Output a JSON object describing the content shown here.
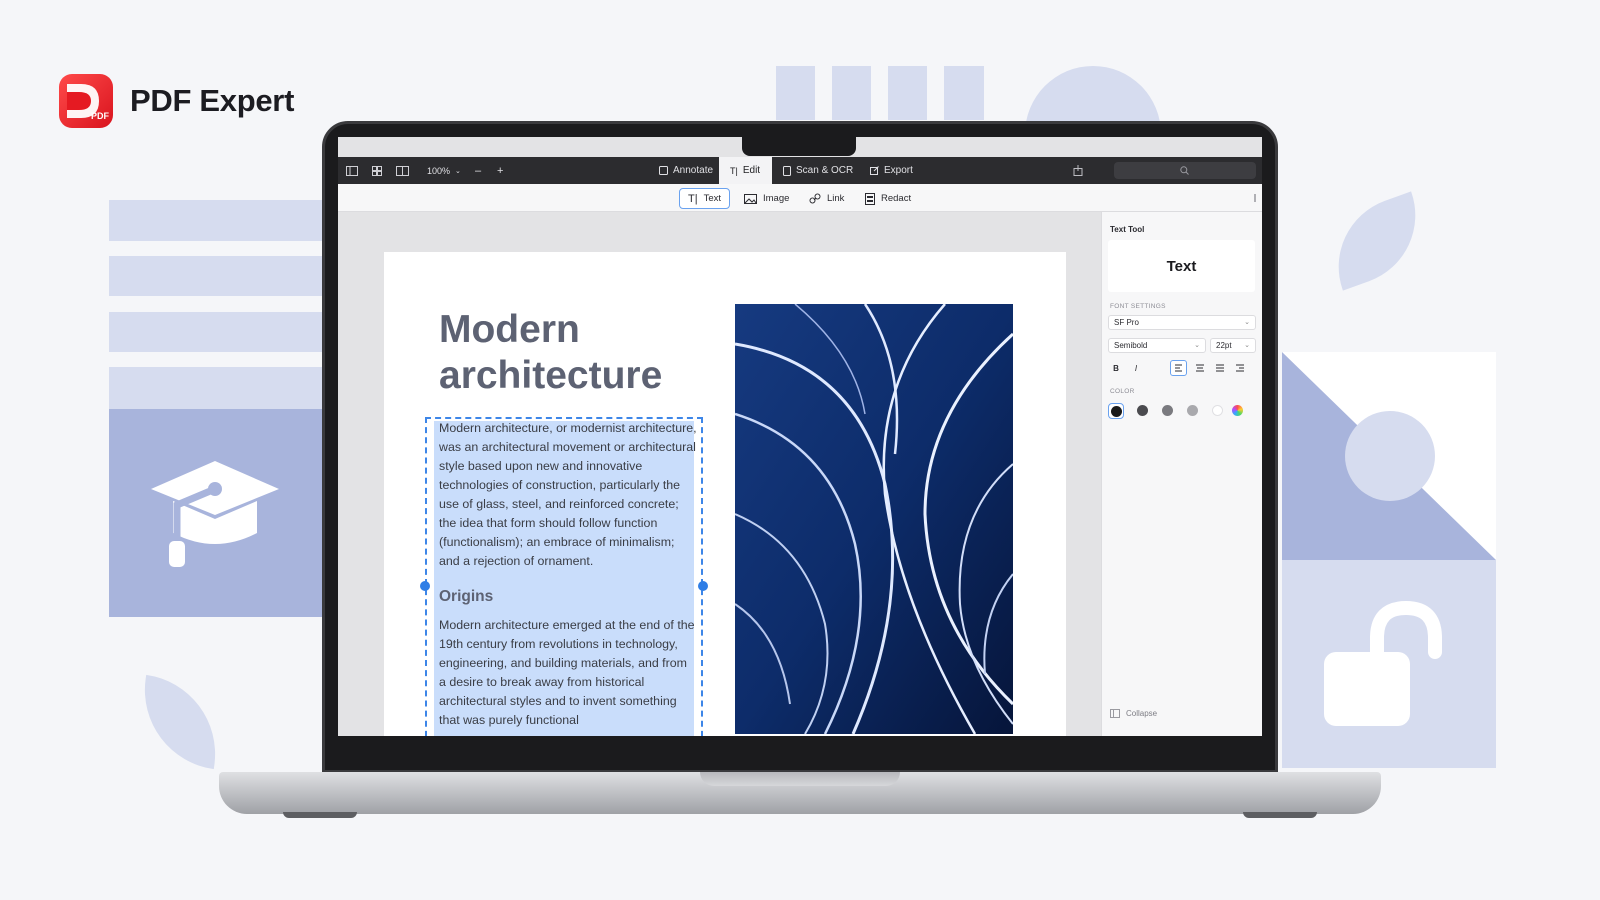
{
  "brand": {
    "name": "PDF Expert",
    "logo_badge": "PDF",
    "logo_icon": "pdf-expert-logo-icon"
  },
  "toolbar": {
    "zoom": "100%",
    "zoom_out": "–",
    "zoom_in": "+",
    "modes": [
      "Annotate",
      "Edit",
      "Scan & OCR",
      "Export"
    ],
    "active_mode": "Edit"
  },
  "edit_tools": {
    "items": [
      "Text",
      "Image",
      "Link",
      "Redact"
    ],
    "active": "Text"
  },
  "document": {
    "title_line1": "Modern",
    "title_line2": "architecture",
    "paragraph1": "Modern architecture, or modernist architecture, was an architectural movement or architectural style based upon new and innovative technologies of construction, particularly the use of glass, steel, and reinforced concrete; the idea that form should follow function (functionalism); an embrace of minimalism; and a rejection of ornament.",
    "heading2": "Origins",
    "paragraph2": "Modern architecture emerged at the end of the 19th century from revolutions in technology, engineering, and building materials, and from a desire to break away from historical architectural styles and to invent something that was purely functional"
  },
  "panel": {
    "title": "Text Tool",
    "preview": "Text",
    "font_settings_label": "FONT SETTINGS",
    "font_family": "SF Pro",
    "font_weight": "Semibold",
    "font_size": "22pt",
    "bold": "B",
    "italic": "I",
    "color_label": "COLOR",
    "colors": [
      "#1a1a1a",
      "#4b4b4f",
      "#7a7a7f",
      "#a9a9ad"
    ],
    "collapse": "Collapse"
  },
  "colors": {
    "accent": "#3d86e8",
    "brand": "#e51a22",
    "decoration": "#d6dcef",
    "decoration_dark": "#a8b4dc"
  }
}
